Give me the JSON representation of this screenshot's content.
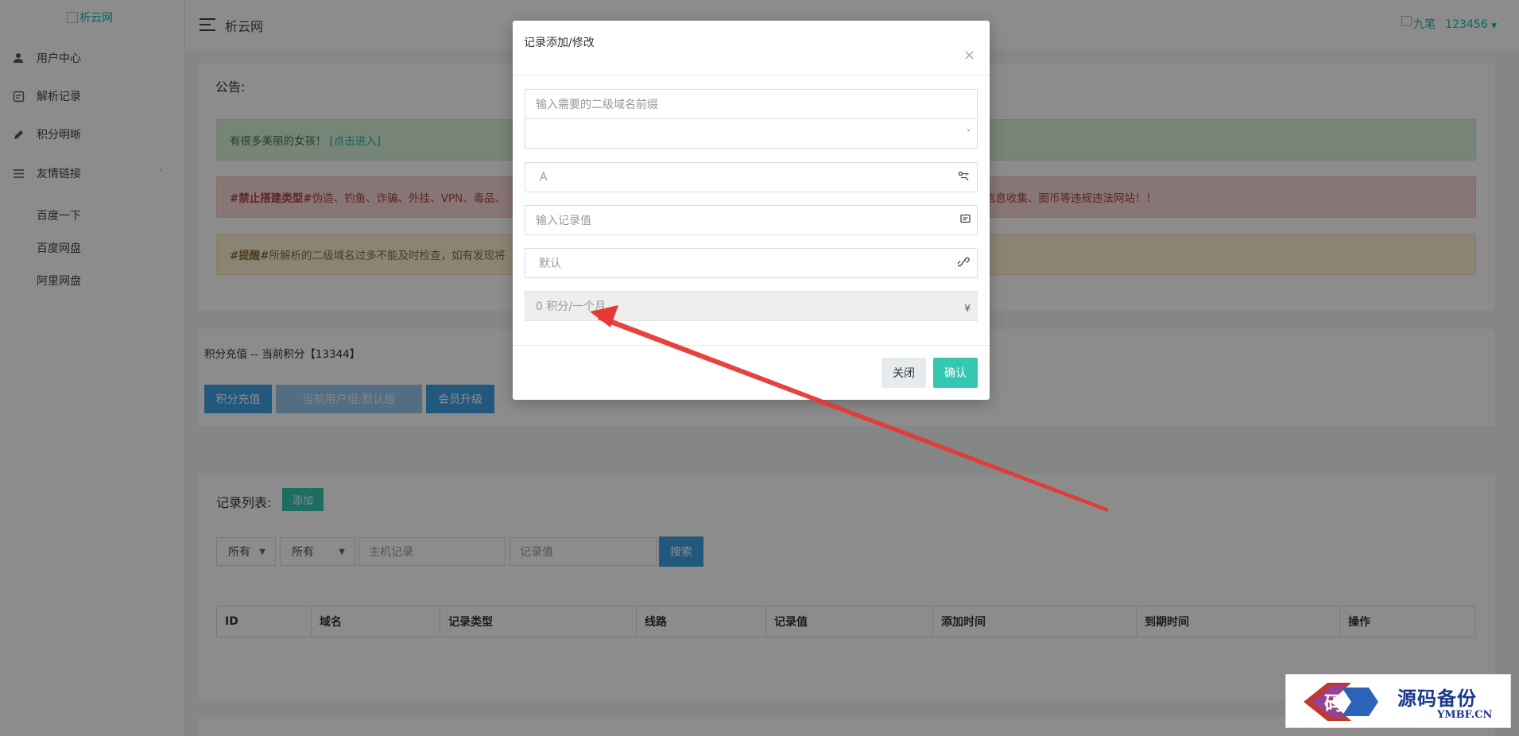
{
  "logo": {
    "alt": "析云网"
  },
  "sidebar": {
    "items": [
      {
        "icon": "user-icon",
        "label": "用户中心"
      },
      {
        "icon": "record-icon",
        "label": "解析记录"
      },
      {
        "icon": "pencil-icon",
        "label": "积分明晰"
      },
      {
        "icon": "list-icon",
        "label": "友情链接"
      }
    ],
    "links": [
      "百度一下",
      "百度网盘",
      "阿里网盘"
    ]
  },
  "header": {
    "title": "析云网",
    "user_alt": "九笔",
    "username": "123456"
  },
  "notice": {
    "title": "公告:",
    "success_text": "有很多美丽的女孩！",
    "success_link": "[点击进入]",
    "danger_tag": "#禁止搭建类型#",
    "danger_text": " 伪造、钓鱼、诈骗、外挂、VPN、毒品、",
    "danger_tail": "信息收集、圈币等违规违法网站！！",
    "warning_tag": "#提醒#",
    "warning_text": " 所解析的二级域名过多不能及时检查，如有发现将"
  },
  "recharge": {
    "title": "积分充值 -- 当前积分【13344】",
    "btn_recharge": "积分充值",
    "btn_group": "当前用户组:默认组",
    "btn_upgrade": "会员升级"
  },
  "records": {
    "title": "记录列表:",
    "add_label": "添加",
    "filter_type": "所有",
    "filter_line": "所有",
    "host_placeholder": "主机记录",
    "value_placeholder": "记录值",
    "search_label": "搜索",
    "columns": [
      "ID",
      "域名",
      "记录类型",
      "线路",
      "记录值",
      "添加时间",
      "到期时间",
      "操作"
    ]
  },
  "modal": {
    "title": "记录添加/修改",
    "close_x": "×",
    "subdomain_placeholder": "输入需要的二级域名前缀",
    "domain_select": "",
    "record_type": "A",
    "record_value_placeholder": "输入记录值",
    "line": "默认",
    "cost": "0 积分/一个月",
    "currency_symbol": "¥",
    "btn_close": "关闭",
    "btn_confirm": "确认"
  },
  "watermark": {
    "title": "源码备份",
    "domain": "YMBF.CN",
    "badge_char": "码"
  },
  "colors": {
    "accent": "#1fb5ac",
    "primary": "#3ea1e5",
    "teal_button": "#34c8b3",
    "arrow": "#e53935"
  }
}
